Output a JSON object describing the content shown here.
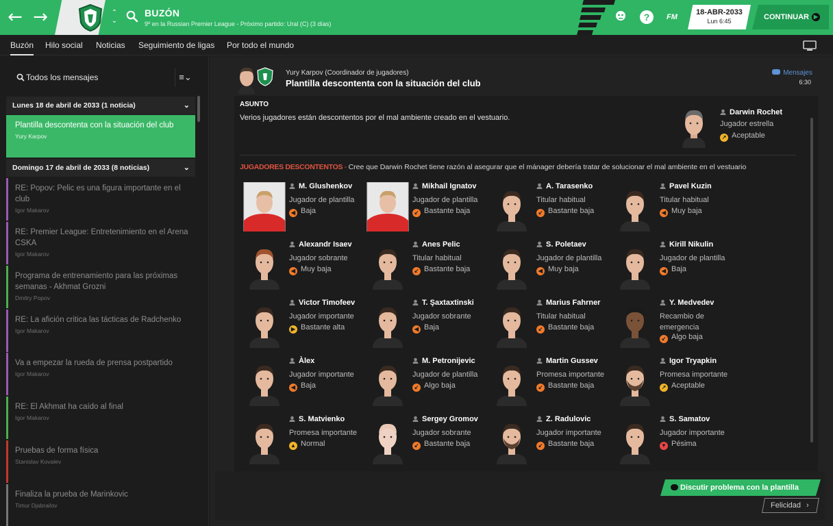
{
  "colors": {
    "accent": "#2fb564",
    "accent_dark": "#1f9a51",
    "panel": "#1c1c1c",
    "link": "#5e93d6"
  },
  "header": {
    "title": "BUZÓN",
    "subtitle": "9º en la Russian Premier League - Próximo partido: Ural (C) (3 días)",
    "date": "18-ABR-2033",
    "time": "Lun 6:45",
    "continue_label": "CONTINUAR",
    "fm_label": "FM",
    "help_label": "?"
  },
  "tabs": [
    "Buzón",
    "Hilo social",
    "Noticias",
    "Seguimiento de ligas",
    "Por todo el mundo"
  ],
  "sidebar": {
    "search_label": "Todos los mensajes",
    "groups": [
      {
        "label": "Lunes 18 de abril de 2033 (1 noticia)"
      },
      {
        "label": "Domingo 17 de abril de 2033 (8 noticias)"
      }
    ],
    "messages": [
      {
        "title": "Plantilla descontenta con la situación del club",
        "sender": "Yury Karpov",
        "selected": true,
        "bar": "#3bb867"
      },
      {
        "title": "RE: Popov: Pelic es una figura importante en el club",
        "sender": "Igor Makarov",
        "bar": "#9b59b6"
      },
      {
        "title": "RE: Premier League: Entretenimiento en el Arena CSKA",
        "sender": "Igor Makarov",
        "bar": "#9b59b6"
      },
      {
        "title": "Programa de entrenamiento para las próximas semanas - Akhmat Grozni",
        "sender": "Dmitry Popov",
        "bar": "#4caf50"
      },
      {
        "title": "RE: La afición critica las tácticas de Radchenko",
        "sender": "Igor Makarov",
        "bar": "#9b59b6"
      },
      {
        "title": "Va a empezar la rueda de prensa postpartido",
        "sender": "Igor Makarov",
        "bar": "#9b59b6"
      },
      {
        "title": "RE: El Akhmat ha caído al final",
        "sender": "Igor Makarov",
        "bar": "#4caf50"
      },
      {
        "title": "Pruebas de forma física",
        "sender": "Stanislav Kovalev",
        "bar": "#c0392b"
      },
      {
        "title": "Finaliza la prueba de Marinkovic",
        "sender": "Timur Djabrailov",
        "bar": "#777777"
      }
    ]
  },
  "message": {
    "sender": "Yury Karpov  (Coordinador de jugadores)",
    "subject": "Plantilla descontenta con la situación del club",
    "link_label": "Mensajes",
    "time": "6:30",
    "asunto_heading": "ASUNTO",
    "asunto_text": "Verios jugadores están descontentos por el mal ambiente creado en el vestuario.",
    "star": {
      "name": "Darwin Rochet",
      "role": "Jugador estrella",
      "mood": "Aceptable",
      "mood_icon": "up-right"
    },
    "unhappy_heading": "JUGADORES DESCONTENTOS",
    "unhappy_sep": " - ",
    "unhappy_text": "Cree que Darwin Rochet tiene razón al asegurar que el mánager debería tratar de solucionar el mal ambiente en el vestuario"
  },
  "players": [
    {
      "name": "M. Glushenkov",
      "role": "Jugador de plantilla",
      "mood": "Baja",
      "mood_icon": "left",
      "face": "photo"
    },
    {
      "name": "Mikhail Ignatov",
      "role": "Jugador de plantilla",
      "mood": "Bastante baja",
      "mood_icon": "down-left",
      "face": "photo"
    },
    {
      "name": "A. Tarasenko",
      "role": "Titular habitual",
      "mood": "Bastante baja",
      "mood_icon": "down-left",
      "face": "dark-hair"
    },
    {
      "name": "Pavel Kuzin",
      "role": "Titular habitual",
      "mood": "Muy baja",
      "mood_icon": "left",
      "face": "dark-hair"
    },
    {
      "name": "Alexandr Isaev",
      "role": "Jugador sobrante",
      "mood": "Muy baja",
      "mood_icon": "left",
      "face": "red-hair"
    },
    {
      "name": "Anes Pelic",
      "role": "Titular habitual",
      "mood": "Bastante baja",
      "mood_icon": "down-left",
      "face": "dark-hair"
    },
    {
      "name": "S. Poletaev",
      "role": "Jugador de plantilla",
      "mood": "Muy baja",
      "mood_icon": "left",
      "face": "dark-hair"
    },
    {
      "name": "Kirill Nikulin",
      "role": "Jugador de plantilla",
      "mood": "Baja",
      "mood_icon": "left",
      "face": "dark-hair"
    },
    {
      "name": "Victor Timofeev",
      "role": "Jugador importante",
      "mood": "Bastante alta",
      "mood_icon": "right",
      "face": "dark-hair"
    },
    {
      "name": "T. Şaxtaxtinski",
      "role": "Jugador sobrante",
      "mood": "Baja",
      "mood_icon": "left",
      "face": "dark-hair"
    },
    {
      "name": "Marius Fahrner",
      "role": "Titular habitual",
      "mood": "Bastante baja",
      "mood_icon": "down-left",
      "face": "dark-hair"
    },
    {
      "name": "Y. Medvedev",
      "role": "Recambio de emergencia",
      "mood": "Algo baja",
      "mood_icon": "down-left",
      "face": "dark-skin"
    },
    {
      "name": "Àlex",
      "role": "Jugador importante",
      "mood": "Baja",
      "mood_icon": "left",
      "face": "dark-hair"
    },
    {
      "name": "M. Petronijevic",
      "role": "Jugador de plantilla",
      "mood": "Algo baja",
      "mood_icon": "down-left",
      "face": "dark-hair"
    },
    {
      "name": "Martin Gussev",
      "role": "Promesa importante",
      "mood": "Bastante baja",
      "mood_icon": "down-left",
      "face": "dark-hair"
    },
    {
      "name": "Igor Tryapkin",
      "role": "Promesa importante",
      "mood": "Aceptable",
      "mood_icon": "up-right",
      "face": "bearded"
    },
    {
      "name": "S. Matvienko",
      "role": "Promesa importante",
      "mood": "Normal",
      "mood_icon": "up",
      "face": "dark-hair"
    },
    {
      "name": "Sergey Gromov",
      "role": "Jugador sobrante",
      "mood": "Bastante baja",
      "mood_icon": "down-left",
      "face": "bald"
    },
    {
      "name": "Z. Radulovic",
      "role": "Jugador importante",
      "mood": "Bastante baja",
      "mood_icon": "down-left",
      "face": "bearded"
    },
    {
      "name": "S. Samatov",
      "role": "Jugador importante",
      "mood": "Pésima",
      "mood_icon": "down",
      "face": "dark-hair"
    }
  ],
  "actions": {
    "discuss_label": "Discutir problema con la plantilla",
    "felicidad_label": "Felicidad"
  }
}
